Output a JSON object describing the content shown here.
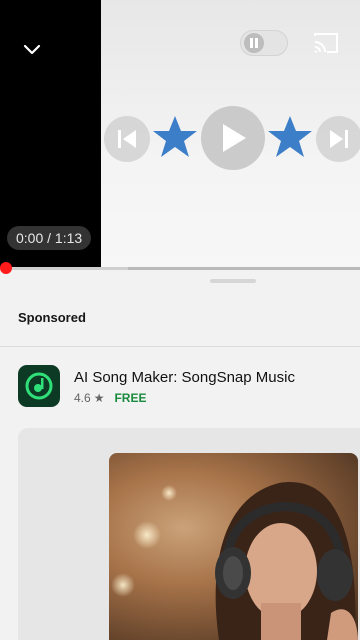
{
  "player": {
    "time_display": "0:00 / 1:13",
    "progress_fraction": 0.0,
    "icons": {
      "collapse": "chevron-down-icon",
      "pause_toggle": "pause-icon",
      "cast": "cast-icon",
      "previous": "skip-previous-icon",
      "play": "play-icon",
      "next": "skip-next-icon",
      "decoration": "star-icon"
    },
    "colors": {
      "scrubber": "#ff1b1b",
      "star": "#3d7ec8"
    }
  },
  "ad": {
    "label": "Sponsored",
    "app_name": "AI Song Maker: SongSnap Music",
    "rating": "4.6",
    "rating_icon": "★",
    "price": "FREE",
    "price_color": "#1a8a3e",
    "icon": "music-note-icon"
  }
}
